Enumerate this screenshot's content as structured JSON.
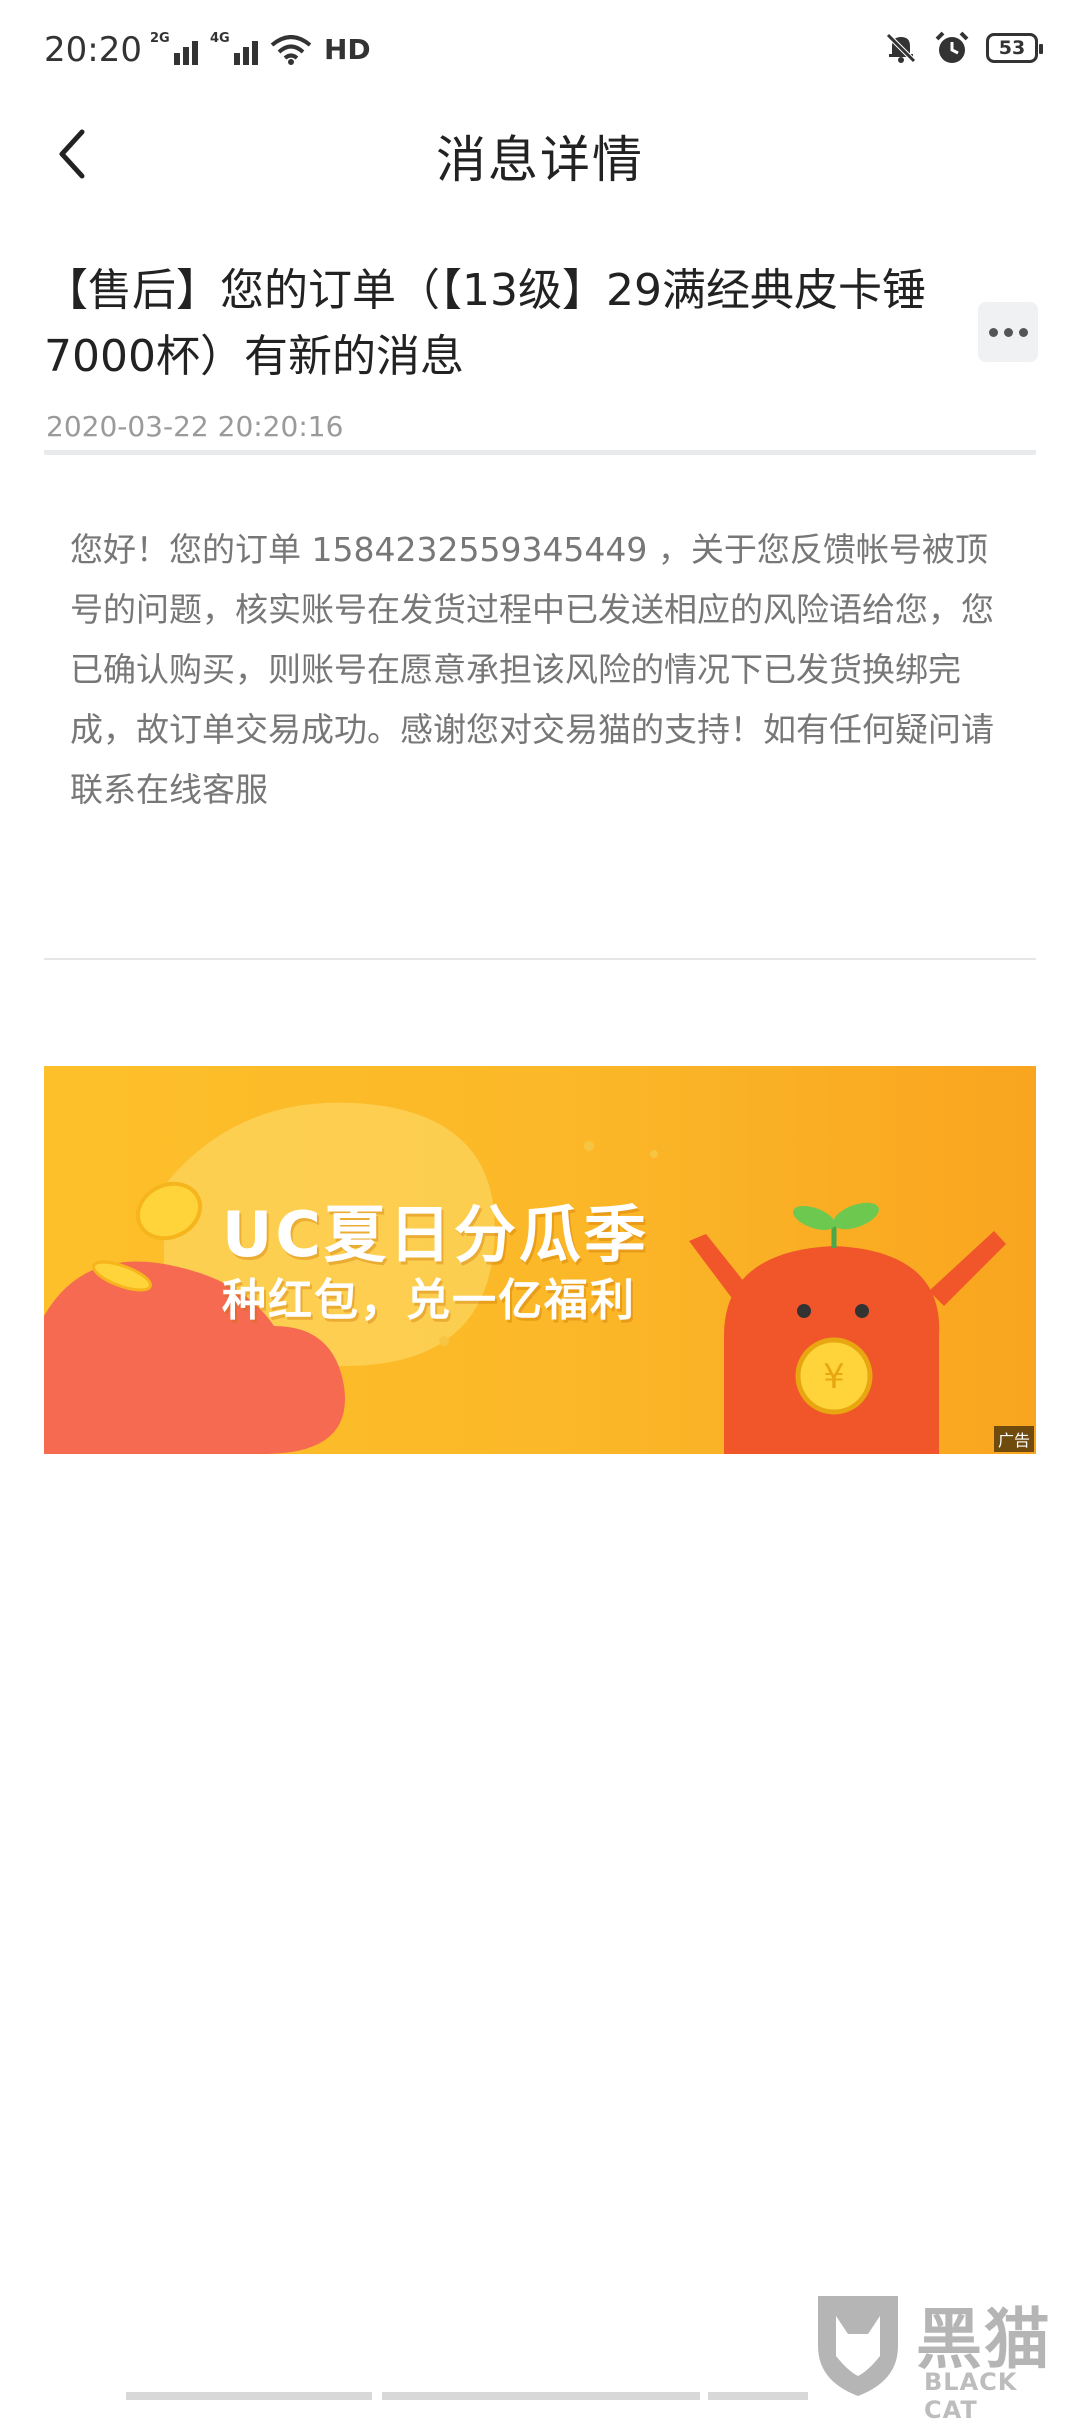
{
  "status_bar": {
    "time": "20:20",
    "signal_1_label": "2G",
    "signal_2_label": "4G",
    "hd_label": "HD",
    "battery": "53"
  },
  "header": {
    "title": "消息详情"
  },
  "message": {
    "title": "【售后】您的订单（【13级】29满经典皮卡锤7000杯）有新的消息",
    "time": "2020-03-22 20:20:16",
    "body": "您好！您的订单 1584232559345449 ，关于您反馈帐号被顶号的问题，核实账号在发货过程中已发送相应的风险语给您，您已确认购买，则账号在愿意承担该风险的情况下已发货换绑完成，故订单交易成功。感谢您对交易猫的支持！如有任何疑问请联系在线客服"
  },
  "ad": {
    "headline": "UC夏日分瓜季",
    "subline": "种红包，兑一亿福利",
    "label": "广告"
  },
  "watermark": {
    "text_cn": "黑猫",
    "text_en": "BLACK CAT"
  },
  "colors": {
    "ad_background": "#fbb728",
    "ad_character": "#f0562a",
    "watermark": "#b5b5b5"
  }
}
